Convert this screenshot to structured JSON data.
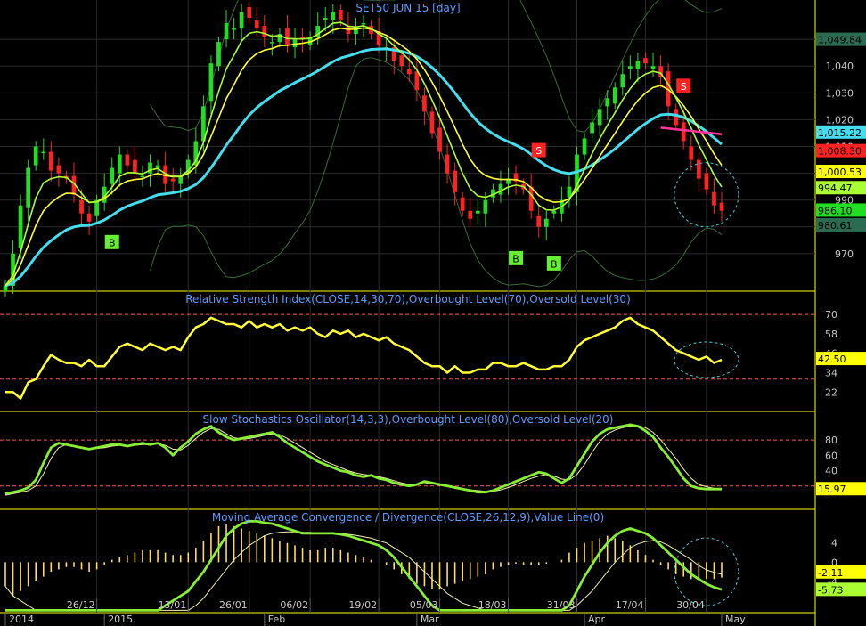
{
  "colors": {
    "background": "#000000",
    "axis_line": "#ffff00",
    "grid": "#2a2a2a",
    "title_text": "#5a9cff",
    "tick_text": "#c8c8c8",
    "candle_up": "#22dd22",
    "candle_down": "#ff2222",
    "bollinger": "#3a6a3a",
    "sma_fast": "#ffff33",
    "sma_slow": "#aaff33",
    "ema_long": "#44ddee",
    "magenta": "#ff3399",
    "level_line": "#ff5555",
    "rsi": "#ffff33",
    "stoch_k": "#88ee33",
    "stoch_d": "#f0f0b0",
    "macd_line": "#88ee33",
    "signal_line": "#f0f0b0",
    "hist": "#ffdd55",
    "circle": "#44ccdd",
    "signal_buy": "#66ee33",
    "signal_sell": "#ff2222"
  },
  "chart_data": [
    {
      "type": "candlestick",
      "title": "SET50 JUN 15   [day]",
      "ylim": [
        959,
        1062
      ],
      "y_ticks": [
        970,
        980,
        990,
        1000,
        1010,
        1020,
        1030,
        1040,
        1050
      ],
      "x_ticks": [
        {
          "label": "26/12",
          "index": 12
        },
        {
          "label": "13/01",
          "index": 24
        },
        {
          "label": "26/01",
          "index": 32
        },
        {
          "label": "06/02",
          "index": 40
        },
        {
          "label": "19/02",
          "index": 49
        },
        {
          "label": "05/03",
          "index": 57
        },
        {
          "label": "18/03",
          "index": 66
        },
        {
          "label": "31/03",
          "index": 75
        },
        {
          "label": "17/04",
          "index": 84
        },
        {
          "label": "30/04",
          "index": 92
        }
      ],
      "month_labels": [
        {
          "label": "2014",
          "index": 0
        },
        {
          "label": "2015",
          "index": 13
        },
        {
          "label": "Feb",
          "index": 34
        },
        {
          "label": "Mar",
          "index": 54
        },
        {
          "label": "Apr",
          "index": 76
        },
        {
          "label": "May",
          "index": 94
        }
      ],
      "close": [
        958,
        970,
        988,
        1002,
        1010,
        1008,
        1001,
        1000,
        998,
        992,
        985,
        982,
        990,
        995,
        1002,
        1007,
        1003,
        1000,
        999,
        1004,
        1003,
        996,
        997,
        999,
        1005,
        1012,
        1025,
        1041,
        1049,
        1056,
        1054,
        1060,
        1058,
        1054,
        1051,
        1049,
        1052,
        1048,
        1050,
        1050,
        1051,
        1055,
        1058,
        1060,
        1057,
        1052,
        1054,
        1056,
        1052,
        1048,
        1047,
        1042,
        1040,
        1037,
        1031,
        1023,
        1015,
        1008,
        1000,
        993,
        986,
        983,
        986,
        990,
        994,
        996,
        998,
        997,
        994,
        986,
        980,
        983,
        986,
        990,
        995,
        1007,
        1013,
        1019,
        1024,
        1028,
        1032,
        1037,
        1040,
        1042,
        1041,
        1040,
        1036,
        1025,
        1018,
        1012,
        1005,
        998,
        994,
        988,
        986
      ],
      "markers": [
        {
          "type": "B",
          "index": 14,
          "low": 979
        },
        {
          "type": "B",
          "index": 67,
          "low": 973
        },
        {
          "type": "B",
          "index": 72,
          "low": 971
        },
        {
          "type": "S",
          "index": 70,
          "high": 1004
        },
        {
          "type": "S",
          "index": 89,
          "high": 1028
        }
      ],
      "price_labels": [
        {
          "text": "1,049.84",
          "value": 1049.84,
          "bg": "#2b6b52",
          "fg": "#000000"
        },
        {
          "text": "1,015.22",
          "value": 1015.22,
          "bg": "#44ddee",
          "fg": "#000000"
        },
        {
          "text": "1,008.30",
          "value": 1008.3,
          "bg": "#ff2222",
          "fg": "#000000"
        },
        {
          "text": "1,000.53",
          "value": 1000.53,
          "bg": "#ffff00",
          "fg": "#000000"
        },
        {
          "text": "994.47",
          "value": 994.47,
          "bg": "#aaff33",
          "fg": "#000000"
        },
        {
          "text": "986.10",
          "value": 986.1,
          "bg": "#22dd22",
          "fg": "#000000"
        },
        {
          "text": "980.61",
          "value": 980.61,
          "bg": "#2b6b52",
          "fg": "#000000"
        }
      ]
    },
    {
      "type": "line",
      "title": "Relative Strength Index(CLOSE,14,30,70),Overbought Level(70),Oversold Level(30)",
      "ylim": [
        15,
        80
      ],
      "y_ticks": [
        22,
        34,
        46,
        58,
        70
      ],
      "levels": [
        70,
        30
      ],
      "values": [
        22,
        22,
        18,
        28,
        30,
        38,
        45,
        42,
        40,
        40,
        38,
        42,
        38,
        38,
        44,
        50,
        52,
        50,
        48,
        52,
        50,
        48,
        50,
        48,
        56,
        62,
        64,
        68,
        66,
        64,
        64,
        62,
        66,
        62,
        64,
        62,
        64,
        60,
        62,
        60,
        62,
        58,
        56,
        60,
        58,
        60,
        56,
        58,
        56,
        54,
        56,
        52,
        50,
        48,
        44,
        40,
        38,
        38,
        34,
        38,
        34,
        34,
        36,
        36,
        40,
        40,
        38,
        38,
        40,
        38,
        36,
        36,
        38,
        38,
        42,
        50,
        54,
        56,
        58,
        60,
        62,
        66,
        68,
        64,
        62,
        60,
        56,
        52,
        48,
        46,
        44,
        42,
        44,
        40,
        42
      ],
      "value_label": {
        "text": "42.50",
        "value": 42.5,
        "bg": "#ffff00",
        "fg": "#000000"
      }
    },
    {
      "type": "line",
      "title": "Slow Stochastics Oscillator(14,3,3),Overbought Level(80),Oversold Level(20)",
      "ylim": [
        0,
        108
      ],
      "y_ticks": [
        20,
        40,
        60,
        80
      ],
      "levels": [
        80,
        20
      ],
      "k": [
        10,
        12,
        14,
        18,
        28,
        50,
        70,
        76,
        74,
        72,
        70,
        68,
        70,
        72,
        74,
        74,
        72,
        74,
        76,
        74,
        76,
        70,
        60,
        70,
        78,
        88,
        94,
        98,
        90,
        84,
        80,
        82,
        84,
        86,
        88,
        90,
        84,
        76,
        70,
        64,
        58,
        52,
        48,
        44,
        40,
        38,
        34,
        32,
        34,
        30,
        28,
        24,
        22,
        20,
        22,
        26,
        24,
        22,
        20,
        18,
        16,
        14,
        12,
        12,
        14,
        18,
        22,
        26,
        30,
        34,
        38,
        36,
        30,
        24,
        30,
        46,
        62,
        78,
        88,
        94,
        96,
        98,
        100,
        98,
        92,
        84,
        70,
        58,
        44,
        30,
        20,
        17,
        16,
        16,
        16
      ],
      "d": [
        8,
        10,
        12,
        14,
        20,
        36,
        56,
        70,
        74,
        72,
        71,
        69,
        69,
        70,
        72,
        73,
        73,
        73,
        74,
        74,
        75,
        73,
        68,
        67,
        73,
        82,
        90,
        95,
        94,
        88,
        83,
        81,
        82,
        84,
        86,
        88,
        87,
        82,
        76,
        70,
        64,
        58,
        52,
        48,
        44,
        40,
        37,
        35,
        34,
        32,
        30,
        27,
        24,
        22,
        22,
        23,
        24,
        23,
        21,
        19,
        17,
        15,
        14,
        13,
        13,
        15,
        18,
        22,
        26,
        30,
        33,
        35,
        33,
        29,
        28,
        35,
        48,
        64,
        78,
        88,
        93,
        96,
        98,
        99,
        96,
        90,
        80,
        68,
        56,
        42,
        30,
        22,
        19,
        17,
        16
      ],
      "value_label": {
        "text": "15.97",
        "value": 15.97,
        "bg": "#ffff00",
        "fg": "#000000"
      }
    },
    {
      "type": "bar",
      "title": "Moving Average Convergence / Divergence(CLOSE,26,12,9),Value Line(0)",
      "ylim": [
        -9,
        9.5
      ],
      "y_ticks": [
        -4,
        0,
        4
      ],
      "hist": [
        -5,
        -7,
        -6,
        -5,
        -4,
        -3,
        -2,
        -1.5,
        -1,
        -1,
        -1.5,
        -2,
        -1.5,
        -0.5,
        0.5,
        1,
        1.5,
        2,
        2.5,
        2.5,
        2.5,
        2,
        1.5,
        1.5,
        2,
        3,
        4.5,
        6,
        7.5,
        8,
        7.5,
        7,
        6.5,
        6,
        5.5,
        5,
        4.5,
        4,
        3.5,
        3,
        2.5,
        2.5,
        3,
        3,
        2.5,
        2,
        1.5,
        1,
        0.5,
        0,
        -0.5,
        -1.5,
        -2.5,
        -3.5,
        -4.5,
        -5,
        -5.5,
        -5.5,
        -5,
        -4.5,
        -4,
        -3.5,
        -3,
        -2.5,
        -1.5,
        -1,
        -0.5,
        -0.3,
        -0.5,
        -0.5,
        -0.5,
        -0.3,
        0,
        0.5,
        2,
        3,
        4,
        4.5,
        5,
        5.5,
        5,
        4.5,
        3.5,
        2.5,
        1.5,
        0.5,
        -0.5,
        -1.5,
        -2.5,
        -3,
        -3.5,
        -3.5,
        -3.5,
        -3.5,
        -3.2
      ],
      "macd": [
        -10,
        -10,
        -10,
        -10,
        -10,
        -10,
        -10,
        -10,
        -10,
        -10,
        -10,
        -10,
        -10,
        -10,
        -10,
        -10,
        -10,
        -10,
        -10,
        -10,
        -10,
        -9,
        -8,
        -7,
        -6,
        -4,
        -2,
        0.5,
        3,
        5.5,
        7,
        8,
        8.5,
        8.5,
        8.2,
        8,
        7.5,
        7,
        6.5,
        6,
        6,
        6,
        6,
        6,
        5.8,
        5.5,
        5,
        4.5,
        4,
        3.5,
        2.5,
        1,
        -1,
        -3,
        -5,
        -7,
        -9,
        -10,
        -10,
        -10,
        -10,
        -10,
        -10,
        -10,
        -10,
        -10,
        -10,
        -10,
        -10,
        -10,
        -10,
        -10,
        -10,
        -10,
        -9,
        -6,
        -3,
        -0.5,
        2,
        4,
        5.5,
        6.5,
        7,
        6.5,
        6,
        5,
        3.5,
        2,
        0.5,
        -1,
        -2.5,
        -3.5,
        -4.5,
        -5.2,
        -5.7
      ],
      "signal": [
        -5,
        -7,
        -8,
        -9,
        -10,
        -10,
        -10,
        -10,
        -10,
        -10,
        -10,
        -10,
        -10,
        -10,
        -10,
        -10,
        -10,
        -10,
        -10,
        -10,
        -10,
        -10,
        -10,
        -10,
        -10,
        -9,
        -7.5,
        -5.5,
        -3.5,
        -1.5,
        0.5,
        2,
        3.5,
        4.5,
        5.5,
        6,
        6.2,
        6.3,
        6.3,
        6.2,
        6.2,
        6.1,
        6.1,
        6,
        6,
        5.8,
        5.6,
        5.3,
        5,
        4.5,
        4,
        3,
        2,
        1,
        -0.5,
        -2,
        -3.5,
        -5,
        -6.5,
        -7.5,
        -8.5,
        -9,
        -9.5,
        -10,
        -10,
        -10,
        -10,
        -10,
        -10,
        -10,
        -10,
        -10,
        -10,
        -10,
        -10,
        -9,
        -7.5,
        -6,
        -4,
        -2,
        0,
        1.5,
        3,
        3.8,
        4.3,
        4.5,
        4.2,
        3.5,
        2.5,
        1.5,
        0.5,
        -0.7,
        -1.6,
        -2.1,
        -2.5
      ],
      "value_labels": [
        {
          "text": "-2.11",
          "value": -2.11,
          "bg": "#ffff00",
          "fg": "#000000"
        },
        {
          "text": "-5.73",
          "value": -5.73,
          "bg": "#aaff33",
          "fg": "#000000"
        }
      ]
    }
  ]
}
